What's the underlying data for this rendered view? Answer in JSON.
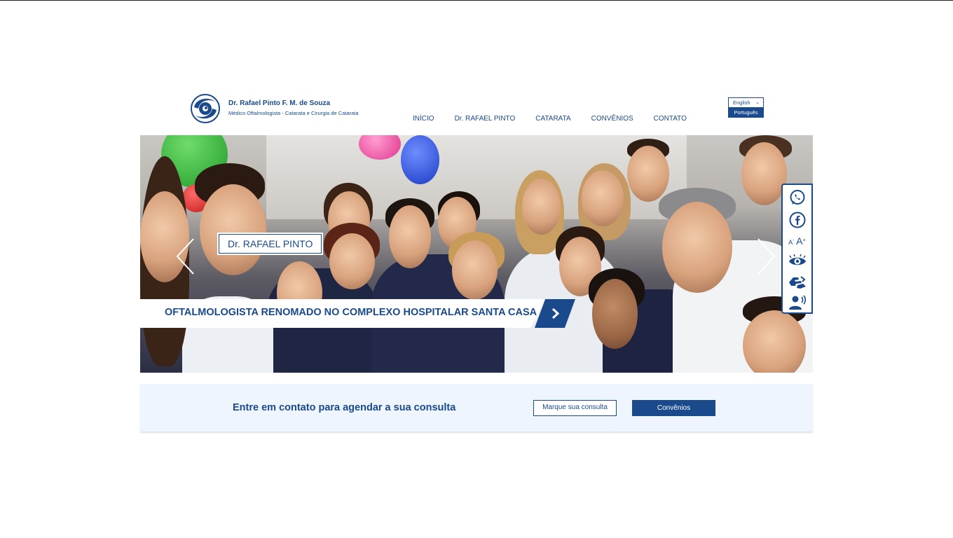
{
  "header": {
    "brand_name": "Dr. Rafael Pinto F. M. de Souza",
    "brand_tagline": "Médico Oftalmologista - Catarata e Cirurgia de Catarata",
    "nav": [
      "INÍCIO",
      "Dr. RAFAEL PINTO",
      "CATARATA",
      "CONVÊNIOS",
      "CONTATO"
    ],
    "language": {
      "selected": "English",
      "option": "Português"
    }
  },
  "hero": {
    "slide_label": "Dr. RAFAEL PINTO",
    "banner_text": "OFTALMOLOGISTA RENOMADO NO COMPLEXO HOSPITALAR SANTA CASA"
  },
  "accessibility": {
    "font_small": "A",
    "font_small_sign": "-",
    "font_large": "A",
    "font_large_sign": "+",
    "icons": [
      "whatsapp-icon",
      "facebook-icon",
      "font-size-icon",
      "contrast-eye-icon",
      "sign-language-icon",
      "screen-reader-icon"
    ]
  },
  "cta": {
    "message": "Entre em contato para agendar a sua consulta",
    "button_schedule": "Marque sua consulta",
    "button_insurance": "Convênios"
  },
  "colors": {
    "primary": "#1a4a8c",
    "cta_bg": "#eef5fc"
  }
}
